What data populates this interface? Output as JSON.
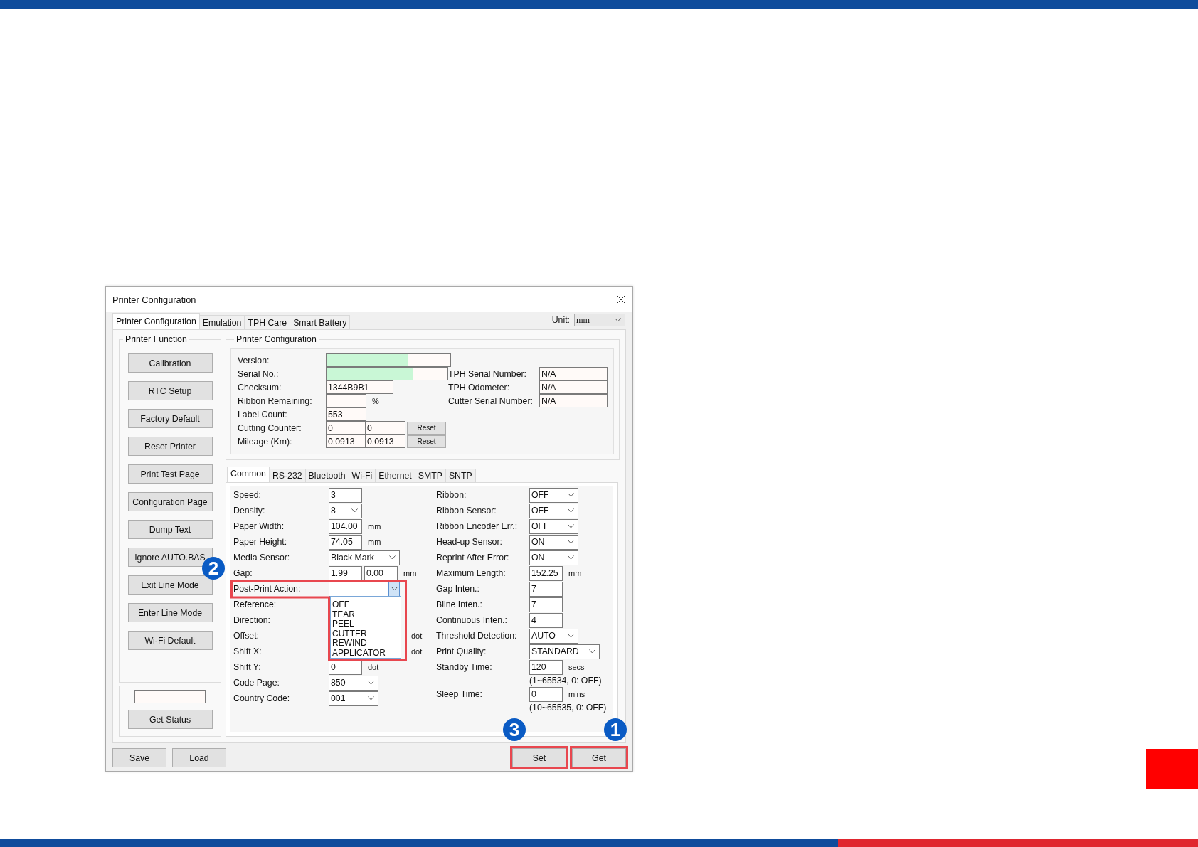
{
  "window": {
    "title": "Printer Configuration"
  },
  "tabs": [
    {
      "label": "Printer Configuration",
      "selected": true
    },
    {
      "label": "Emulation",
      "selected": false
    },
    {
      "label": "TPH Care",
      "selected": false
    },
    {
      "label": "Smart Battery",
      "selected": false
    }
  ],
  "unit": {
    "label": "Unit:",
    "value": "mm"
  },
  "printer_function": {
    "title": "Printer Function",
    "buttons": [
      "Calibration",
      "RTC Setup",
      "Factory Default",
      "Reset Printer",
      "Print Test Page",
      "Configuration Page",
      "Dump Text",
      "Ignore AUTO.BAS",
      "Exit Line Mode",
      "Enter Line Mode",
      "Wi-Fi Default"
    ],
    "status_button": "Get Status"
  },
  "printer_configuration": {
    "title": "Printer Configuration",
    "left": [
      {
        "label": "Version:",
        "kind": "long_bar",
        "level": 0.66
      },
      {
        "label": "Serial No.:",
        "kind": "bar",
        "level": 0.71
      },
      {
        "label": "Checksum:",
        "kind": "text",
        "value": "1344B9B1"
      },
      {
        "label": "Ribbon Remaining:",
        "kind": "number",
        "unit": "%"
      },
      {
        "label": "Label Count:",
        "kind": "number",
        "value": "553"
      },
      {
        "label": "Cutting Counter:",
        "kind": "counter",
        "values": [
          "0",
          "0"
        ],
        "button": "Reset"
      },
      {
        "label": "Mileage (Km):",
        "kind": "counter",
        "values": [
          "0.0913",
          "0.0913"
        ],
        "button": "Reset"
      }
    ],
    "right": [
      {
        "label": "TPH Serial Number:",
        "value": "N/A"
      },
      {
        "label": "TPH Odometer:",
        "value": "N/A"
      },
      {
        "label": "Cutter Serial Number:",
        "value": "N/A"
      }
    ]
  },
  "sub_tabs": [
    {
      "label": "Common",
      "selected": true
    },
    {
      "label": "RS-232",
      "selected": false
    },
    {
      "label": "Bluetooth",
      "selected": false
    },
    {
      "label": "Wi-Fi",
      "selected": false
    },
    {
      "label": "Ethernet",
      "selected": false
    },
    {
      "label": "SMTP",
      "selected": false
    },
    {
      "label": "SNTP",
      "selected": false
    }
  ],
  "common": {
    "left": [
      {
        "label": "Speed:",
        "kind": "input",
        "value": "3"
      },
      {
        "label": "Density:",
        "kind": "select",
        "value": "8"
      },
      {
        "label": "Paper Width:",
        "kind": "input",
        "value": "104.00",
        "unit": "mm"
      },
      {
        "label": "Paper Height:",
        "kind": "input",
        "value": "74.05",
        "unit": "mm"
      },
      {
        "label": "Media Sensor:",
        "kind": "select",
        "value": "Black Mark"
      },
      {
        "label": "Gap:",
        "kind": "pair",
        "values": [
          "1.99",
          "0.00"
        ],
        "unit": "mm"
      },
      {
        "label": "Post-Print Action:",
        "kind": "dropdown",
        "expanded": true,
        "highlighted": true,
        "options": [
          {
            "label": "OFF",
            "selected": false
          },
          {
            "label": "TEAR",
            "selected": false
          },
          {
            "label": "PEEL",
            "selected": false
          },
          {
            "label": "CUTTER",
            "selected": false
          },
          {
            "label": "REWIND",
            "selected": false
          },
          {
            "label": "APPLICATOR",
            "selected": false
          }
        ]
      },
      {
        "label": "Reference:",
        "kind": "hidden"
      },
      {
        "label": "Direction:",
        "kind": "hidden"
      },
      {
        "label": "Offset:",
        "kind": "hidden",
        "unit": "dot"
      },
      {
        "label": "Shift X:",
        "kind": "hidden",
        "unit": "dot"
      },
      {
        "label": "Shift Y:",
        "kind": "input",
        "value": "0",
        "unit": "dot"
      },
      {
        "label": "Code Page:",
        "kind": "select",
        "value": "850"
      },
      {
        "label": "Country Code:",
        "kind": "select",
        "value": "001"
      }
    ],
    "right": [
      {
        "label": "Ribbon:",
        "kind": "select",
        "value": "OFF"
      },
      {
        "label": "Ribbon Sensor:",
        "kind": "select",
        "value": "OFF"
      },
      {
        "label": "Ribbon Encoder Err.:",
        "kind": "select",
        "value": "OFF"
      },
      {
        "label": "Head-up Sensor:",
        "kind": "select",
        "value": "ON"
      },
      {
        "label": "Reprint After Error:",
        "kind": "select",
        "value": "ON"
      },
      {
        "label": "Maximum Length:",
        "kind": "input",
        "value": "152.25",
        "unit": "mm"
      },
      {
        "label": "Gap Inten.:",
        "kind": "input",
        "value": "7"
      },
      {
        "label": "Bline Inten.:",
        "kind": "input",
        "value": "7"
      },
      {
        "label": "Continuous Inten.:",
        "kind": "input",
        "value": "4"
      },
      {
        "label": "Threshold Detection:",
        "kind": "select",
        "value": "AUTO"
      },
      {
        "label": "Print Quality:",
        "kind": "select",
        "value": "STANDARD"
      },
      {
        "label": "Standby Time:",
        "kind": "input",
        "value": "120",
        "unit": "secs"
      },
      {
        "kind": "note",
        "text": "(1~65534, 0: OFF)"
      },
      {
        "label": "Sleep Time:",
        "kind": "input",
        "value": "0",
        "unit": "mins"
      },
      {
        "kind": "note",
        "text": "(10~65535, 0: OFF)"
      }
    ]
  },
  "bottom_buttons": [
    {
      "label": "Save",
      "highlighted": false
    },
    {
      "label": "Load",
      "highlighted": false
    },
    {
      "label": "Set",
      "highlighted": true
    },
    {
      "label": "Get",
      "highlighted": true
    }
  ],
  "callouts": [
    {
      "number": "2"
    },
    {
      "number": "3"
    },
    {
      "number": "1"
    }
  ]
}
